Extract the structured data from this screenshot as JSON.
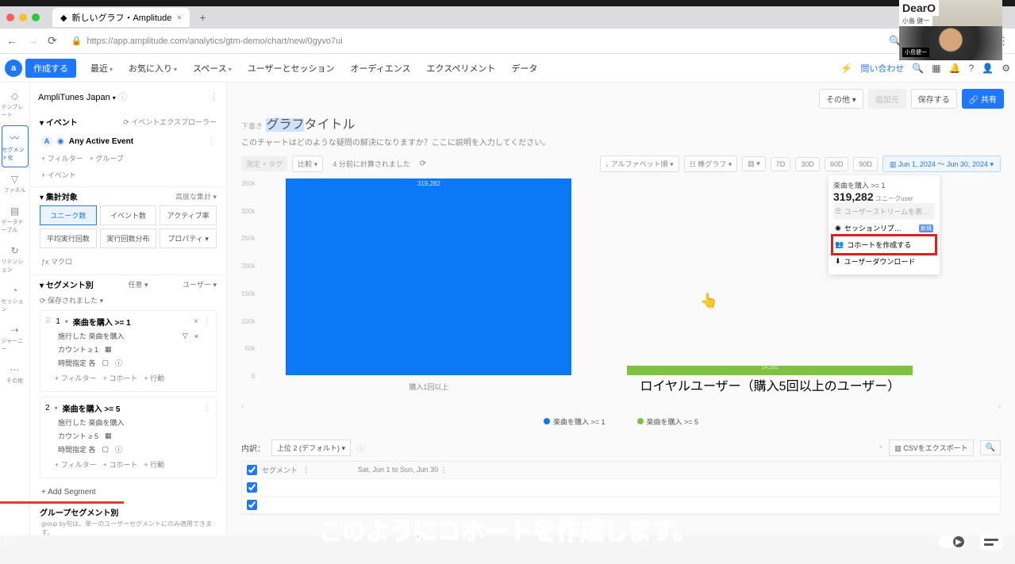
{
  "browser": {
    "tab_title": "新しいグラフ・Amplitude",
    "url": "https://app.amplitude.com/analytics/gtm-demo/chart/new/0gyvo7ui"
  },
  "menu": {
    "create": "作成する",
    "items": [
      "最近",
      "お気に入り",
      "スペース",
      "ユーザーとセッション",
      "オーディエンス",
      "エクスペリメント",
      "データ"
    ],
    "inquiry": "問い合わせ"
  },
  "rail": {
    "items": [
      "テンプレート",
      "セグメント化",
      "ファネル",
      "データテーブル",
      "リテンション",
      "セッション",
      "ジャーニー",
      "その他"
    ]
  },
  "project": "AmpliTunes Japan",
  "events": {
    "header": "イベント",
    "explorer": "イベントエクスプローラー",
    "badge": "A",
    "active": "Any Active Event",
    "add_filter": "+ フィルター",
    "add_group": "+ グループ",
    "add_event": "+ イベント"
  },
  "measure": {
    "header": "集計対象",
    "advanced": "高度な集計",
    "metrics": [
      "ユニーク数",
      "イベント数",
      "アクティブ率",
      "平均実行回数",
      "実行回数分布",
      "プロパティ"
    ],
    "macro": "マクロ"
  },
  "segments": {
    "header": "セグメント別",
    "any": "任意",
    "user": "ユーザー",
    "saved": "保存されました",
    "items": [
      {
        "num": "1",
        "label": "楽曲を購入 >= 1",
        "performed": "施行した  楽曲を購入",
        "count_row": "カウント  ≥  1",
        "time_row": "時間指定  各"
      },
      {
        "num": "2",
        "label": "楽曲を購入 >= 5",
        "performed": "施行した  楽曲を購入",
        "count_row": "カウント  ≥  5",
        "time_row": "時間指定  各"
      }
    ],
    "add_filter": "+ フィルター",
    "add_cohort": "+ コホート",
    "add_action": "+ 行動",
    "add_segment": "+ Add Segment",
    "group_header": "グループセグメント別",
    "group_note": "group by句は、単一のユーザーセグメントにのみ適用できます。"
  },
  "main": {
    "other": "その他",
    "add": "追加元",
    "save": "保存する",
    "share": "共有",
    "draft": "下書き",
    "title_pre": "グラフ",
    "title_post": "タイトル",
    "description": "このチャートはどのような疑問の解決になりますか？ここに説明を入力してください。",
    "ctrl_bar": "測定 + タグ",
    "ctrl_compare": "比較",
    "ctrl_updated": "4 分前に計算されました",
    "sort": "アルファベット順",
    "chart_type": "棒グラフ",
    "date_presets": [
      "7D",
      "30D",
      "60D",
      "90D"
    ],
    "date_range": "Jun 1, 2024 ～ Jun 30, 2024"
  },
  "chart_data": {
    "type": "bar",
    "categories": [
      "購入1回以上",
      "ロイヤルユーザー（購入5回以上のユーザー）"
    ],
    "series": [
      {
        "name": "楽曲を購入 >= 1",
        "values": [
          319282,
          0
        ],
        "color": "#0b78f6"
      },
      {
        "name": "楽曲を購入 >= 5",
        "values": [
          0,
          14281
        ],
        "color": "#7fc241"
      }
    ],
    "ylabel": "ユニーク数",
    "ylim": [
      0,
      350000
    ],
    "y_ticks": [
      "350k",
      "300k",
      "250k",
      "200k",
      "150k",
      "100k",
      "50k",
      "0"
    ],
    "bar1_top_label": "319,282",
    "bar2_top_label": "14,281"
  },
  "popup": {
    "event": "楽曲を購入 >= 1",
    "value": "319,282",
    "unit": "ユニークuser",
    "stream": "ユーザーストリームを表…",
    "replay": "セッションリプ…",
    "replay_badge": "新規",
    "cohort": "コホートを作成する",
    "download": "ユーザーダウンロード"
  },
  "legend": {
    "s1": "楽曲を購入 >= 1",
    "s2": "楽曲を購入 >= 5"
  },
  "table": {
    "breakdown": "内訳：",
    "select": "上位 2 (デフォルト)",
    "export": "CSVをエクスポート",
    "col1": "セグメント",
    "col2": "Sat, Jun 1 to Sun, Jun 30"
  },
  "video": {
    "timestamp": "05",
    "subtitle": "このようにコホートを作成します。"
  },
  "webcam": {
    "brand": "DearO",
    "name": "小島 健一",
    "tag": "小島健一"
  }
}
